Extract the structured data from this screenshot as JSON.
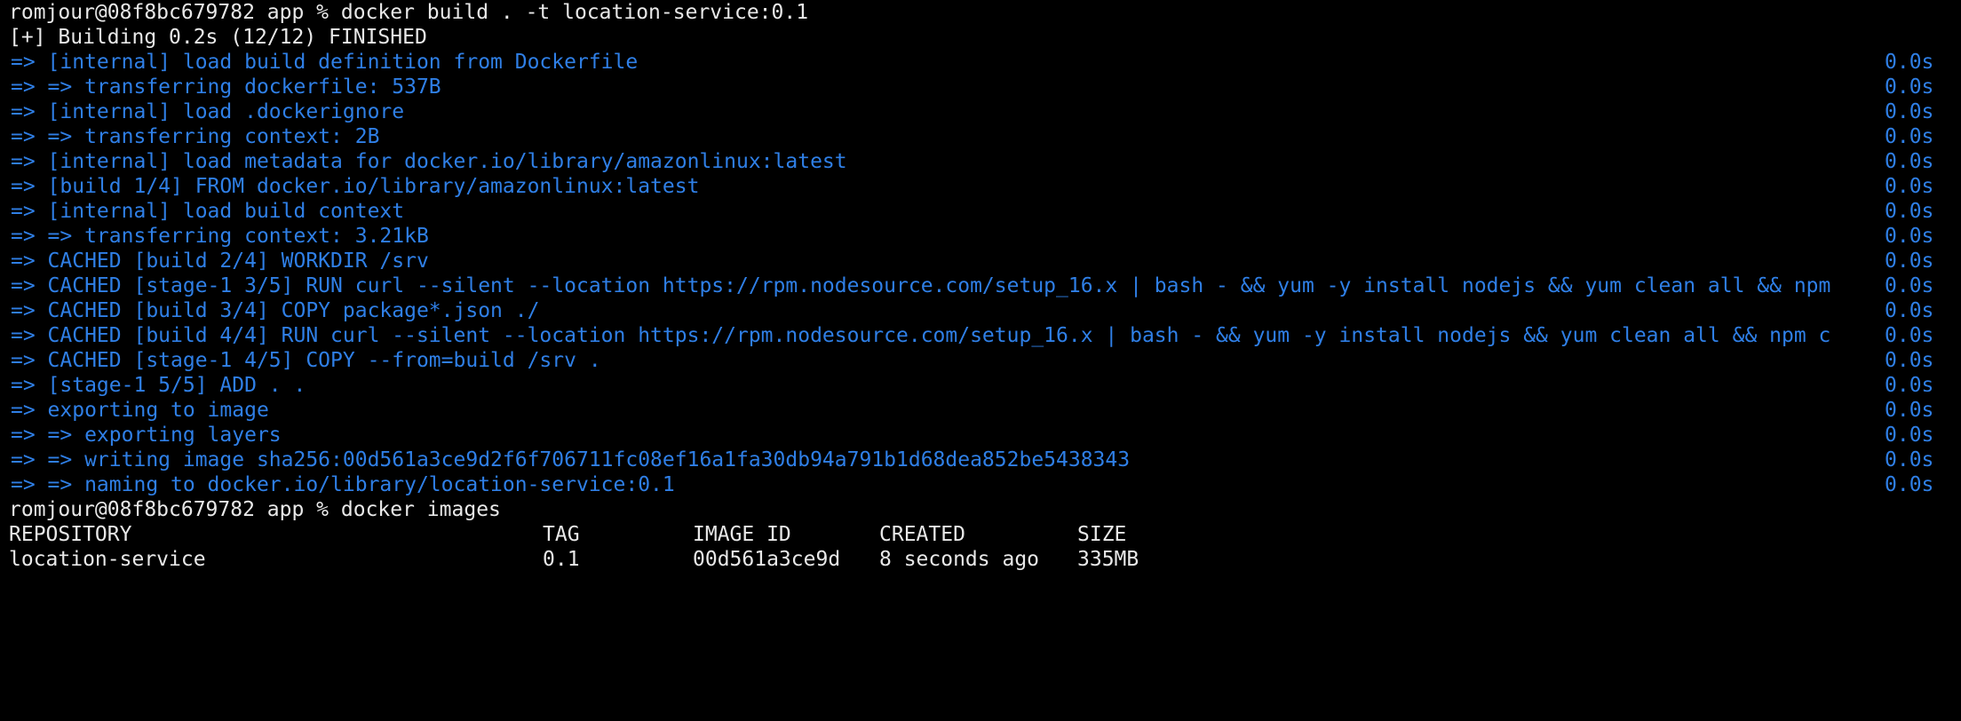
{
  "terminal": {
    "prompt1": "romjour@08f8bc679782 app % docker build . -t location-service:0.1",
    "status": "[+] Building 0.2s (12/12) FINISHED",
    "steps": [
      {
        "text": "=> [internal] load build definition from Dockerfile",
        "time": "0.0s"
      },
      {
        "text": "=> => transferring dockerfile: 537B",
        "time": "0.0s"
      },
      {
        "text": "=> [internal] load .dockerignore",
        "time": "0.0s"
      },
      {
        "text": "=> => transferring context: 2B",
        "time": "0.0s"
      },
      {
        "text": "=> [internal] load metadata for docker.io/library/amazonlinux:latest",
        "time": "0.0s"
      },
      {
        "text": "=> [build 1/4] FROM docker.io/library/amazonlinux:latest",
        "time": "0.0s"
      },
      {
        "text": "=> [internal] load build context",
        "time": "0.0s"
      },
      {
        "text": "=> => transferring context: 3.21kB",
        "time": "0.0s"
      },
      {
        "text": "=> CACHED [build 2/4] WORKDIR /srv",
        "time": "0.0s"
      },
      {
        "text": "=> CACHED [stage-1 3/5] RUN curl --silent --location https://rpm.nodesource.com/setup_16.x | bash - && yum -y install nodejs && yum clean all && npm",
        "time": "0.0s"
      },
      {
        "text": "=> CACHED [build 3/4] COPY package*.json ./",
        "time": "0.0s"
      },
      {
        "text": "=> CACHED [build 4/4] RUN curl --silent --location https://rpm.nodesource.com/setup_16.x | bash - && yum -y install nodejs && yum clean all && npm c",
        "time": "0.0s"
      },
      {
        "text": "=> CACHED [stage-1 4/5] COPY --from=build /srv .",
        "time": "0.0s"
      },
      {
        "text": "=> [stage-1 5/5] ADD . .",
        "time": "0.0s"
      },
      {
        "text": "=> exporting to image",
        "time": "0.0s"
      },
      {
        "text": "=> => exporting layers",
        "time": "0.0s"
      },
      {
        "text": "=> => writing image sha256:00d561a3ce9d2f6f706711fc08ef16a1fa30db94a791b1d68dea852be5438343",
        "time": "0.0s"
      },
      {
        "text": "=> => naming to docker.io/library/location-service:0.1",
        "time": "0.0s"
      }
    ],
    "prompt2": "romjour@08f8bc679782 app % docker images",
    "images_table": {
      "headers": [
        "REPOSITORY",
        "TAG",
        "IMAGE ID",
        "CREATED",
        "SIZE"
      ],
      "rows": [
        [
          "location-service",
          "0.1",
          "00d561a3ce9d",
          "8 seconds ago",
          "335MB"
        ]
      ]
    }
  },
  "colors": {
    "background": "#000000",
    "text": "#e8e8e8",
    "build_step": "#2f7fe6"
  }
}
